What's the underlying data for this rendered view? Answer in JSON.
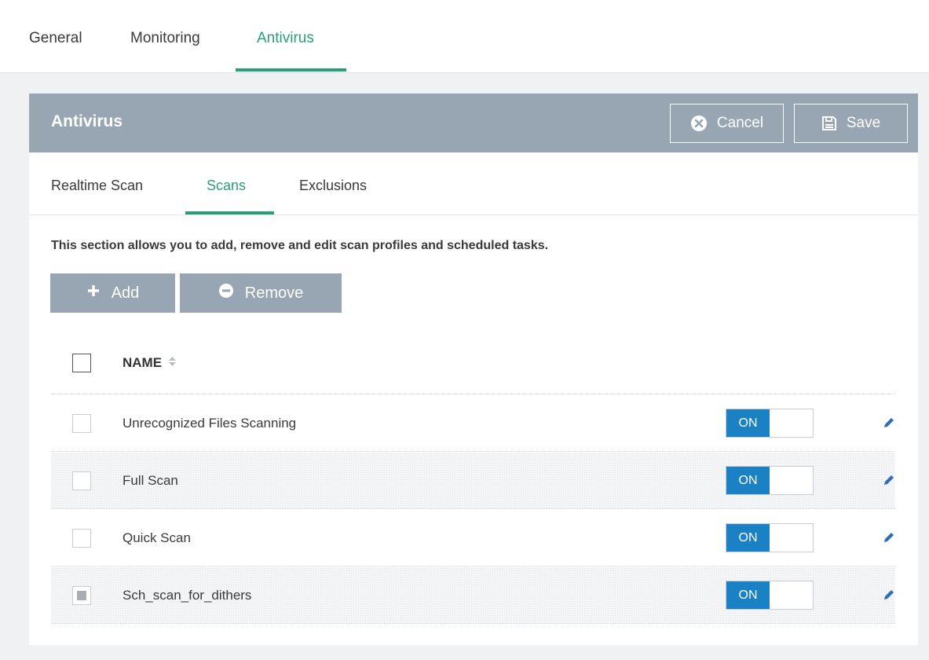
{
  "top_tabs": [
    {
      "label": "General"
    },
    {
      "label": "Monitoring"
    },
    {
      "label": "Antivirus",
      "active": true
    }
  ],
  "panel": {
    "title": "Antivirus",
    "cancel_label": "Cancel",
    "save_label": "Save"
  },
  "sub_tabs": [
    {
      "label": "Realtime Scan"
    },
    {
      "label": "Scans",
      "active": true
    },
    {
      "label": "Exclusions"
    }
  ],
  "description": "This section allows you to add, remove and edit scan profiles and scheduled tasks.",
  "actions": {
    "add_label": "Add",
    "remove_label": "Remove"
  },
  "table": {
    "column_name": "NAME",
    "rows": [
      {
        "name": "Unrecognized Files Scanning",
        "toggle": "ON",
        "checked": false
      },
      {
        "name": "Full Scan",
        "toggle": "ON",
        "checked": false
      },
      {
        "name": "Quick Scan",
        "toggle": "ON",
        "checked": false
      },
      {
        "name": "Sch_scan_for_dithers",
        "toggle": "ON",
        "checked": true
      }
    ]
  },
  "colors": {
    "accent": "#2a9d7a",
    "header": "#97a6b2",
    "toggle_on": "#1a82c4",
    "edit_icon": "#2f6db5"
  },
  "icons": {
    "cancel": "x-circle-icon",
    "save": "floppy-disk-icon",
    "add": "plus-icon",
    "remove": "minus-circle-icon",
    "sort": "sort-arrows-icon",
    "edit": "pencil-icon"
  }
}
